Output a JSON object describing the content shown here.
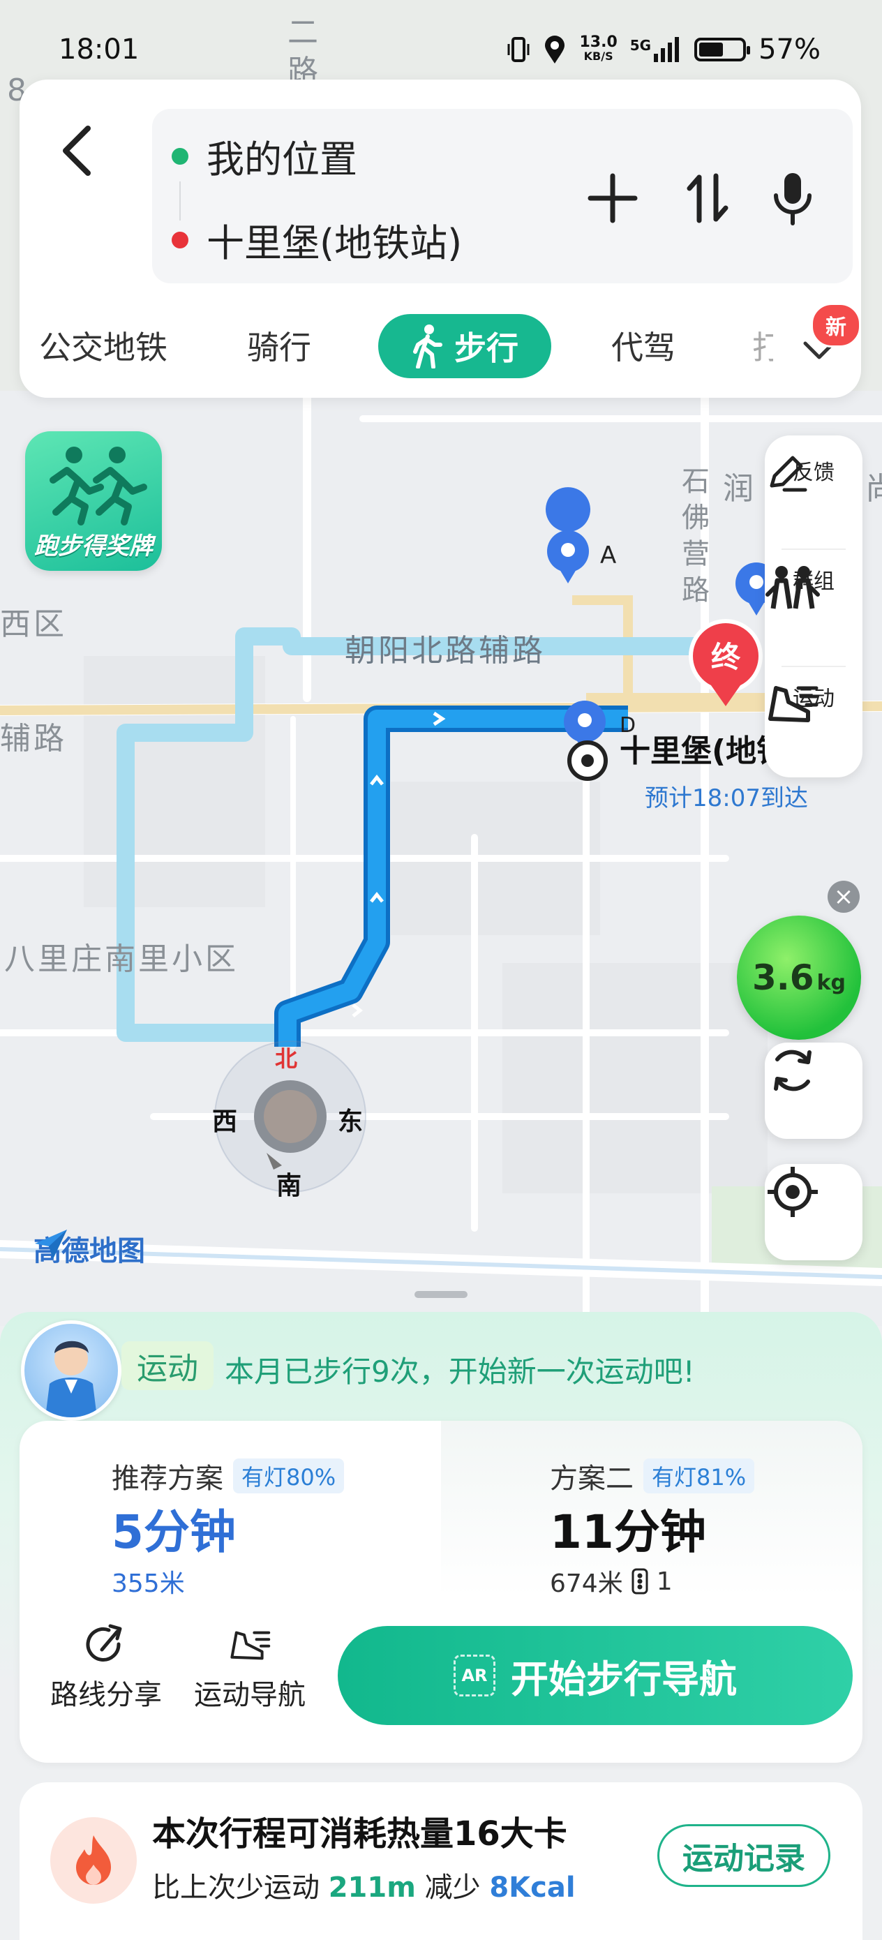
{
  "status_bar": {
    "time": "18:01",
    "net_speed_value": "13.0",
    "net_speed_unit": "KB/S",
    "signal": "5G",
    "battery_percent_text": "57%",
    "battery_level": 0.57
  },
  "route": {
    "start": "我的位置",
    "end": "十里堡(地铁站)"
  },
  "modes": {
    "items": [
      "公交地铁",
      "骑行",
      "步行",
      "代驾",
      "打"
    ],
    "active": "步行",
    "new_badge": "新"
  },
  "map": {
    "labels": {
      "road_1": "朝阳北路辅路",
      "road_2": "辅路",
      "road_3": "路",
      "area_1": "八里庄南里小区",
      "area_2": "石佛营路",
      "area_3": "润",
      "area_4": "西区",
      "area_5": "二",
      "area_6": "8",
      "area_7": "尚"
    },
    "run_badge": "跑步得奖牌",
    "marker_a": "A",
    "marker_d": "D",
    "end_marker": "终",
    "destination_label": "十里堡(地铁",
    "eta": "预计18:07到达",
    "compass": {
      "n": "北",
      "s": "南",
      "e": "东",
      "w": "西"
    },
    "carbon_value": "3.6",
    "carbon_unit": "kg",
    "logo": "高德地图"
  },
  "side_tools": {
    "feedback": "反馈",
    "group": "群组",
    "sport": "运动"
  },
  "sheet": {
    "sport_tag": "运动",
    "sport_message": "本月已步行9次，开始新一次运动吧!",
    "plan1": {
      "title": "推荐方案",
      "light": "有灯80%",
      "time": "5分钟",
      "distance": "355米"
    },
    "plan2": {
      "title": "方案二",
      "light": "有灯81%",
      "time": "11分钟",
      "distance": "674米",
      "lights_count": "1"
    },
    "share": "路线分享",
    "sport_nav": "运动导航",
    "start_button": "开始步行导航",
    "start_icon_text": "AR",
    "calorie_title": "本次行程可消耗热量16大卡",
    "calorie_sub_prefix": "比上次少运动",
    "calorie_sub_distance": "211m",
    "calorie_sub_mid": "减少",
    "calorie_sub_kcal": "8Kcal",
    "record_button": "运动记录"
  },
  "colors": {
    "accent": "#17b890",
    "route_main": "#1a8fe6",
    "route_alt": "#a8ddf0",
    "plan1_time": "#2f6fd6",
    "start_dot": "#1fb573",
    "end_dot": "#e8333a"
  }
}
